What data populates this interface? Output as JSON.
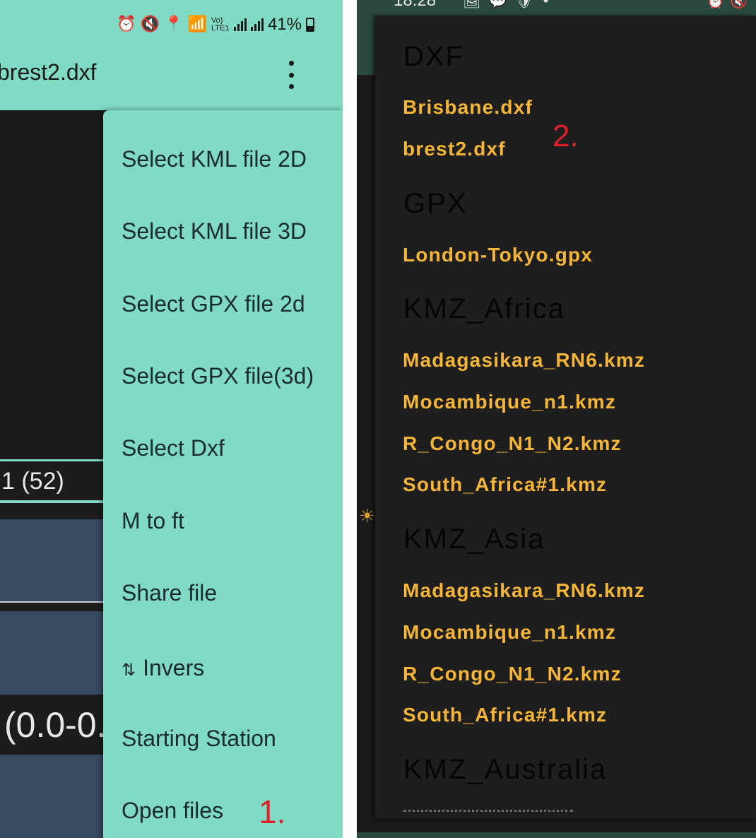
{
  "left": {
    "status": {
      "battery": "41%",
      "volte": "Vo) LTE1"
    },
    "toolbar": {
      "title": "brest2.dxf"
    },
    "background": {
      "count_text": "1 (52)",
      "range_text": "(0.0-0."
    },
    "menu": {
      "items": [
        {
          "label": "Select KML file 2D"
        },
        {
          "label": "Select KML file 3D"
        },
        {
          "label": "Select GPX file 2d"
        },
        {
          "label": "Select GPX file(3d)"
        },
        {
          "label": "Select Dxf"
        },
        {
          "label": "M to ft"
        },
        {
          "label": "Share file"
        },
        {
          "label": "Invers",
          "icon": "sort-arrows-icon"
        },
        {
          "label": "Starting Station"
        },
        {
          "label": "Open files"
        }
      ]
    },
    "annotation": "1."
  },
  "right": {
    "status": {
      "time": "18:28"
    },
    "groups": [
      {
        "header": "DXF",
        "files": [
          "Brisbane.dxf",
          "brest2.dxf"
        ]
      },
      {
        "header": "GPX",
        "files": [
          "London-Tokyo.gpx"
        ]
      },
      {
        "header": "KMZ_Africa",
        "files": [
          "Madagasikara_RN6.kmz",
          "Mocambique_n1.kmz",
          "R_Congo_N1_N2.kmz",
          "South_Africa#1.kmz"
        ]
      },
      {
        "header": "KMZ_Asia",
        "files": [
          "Madagasikara_RN6.kmz",
          "Mocambique_n1.kmz",
          "R_Congo_N1_N2.kmz",
          "South_Africa#1.kmz"
        ]
      },
      {
        "header": "KMZ_Australia",
        "files": []
      }
    ],
    "annotation": "2."
  },
  "colors": {
    "menu_bg": "#80dac4",
    "file_text": "#f4b538",
    "annotation": "#e0202a",
    "panel_bg": "#1e1e1e"
  }
}
